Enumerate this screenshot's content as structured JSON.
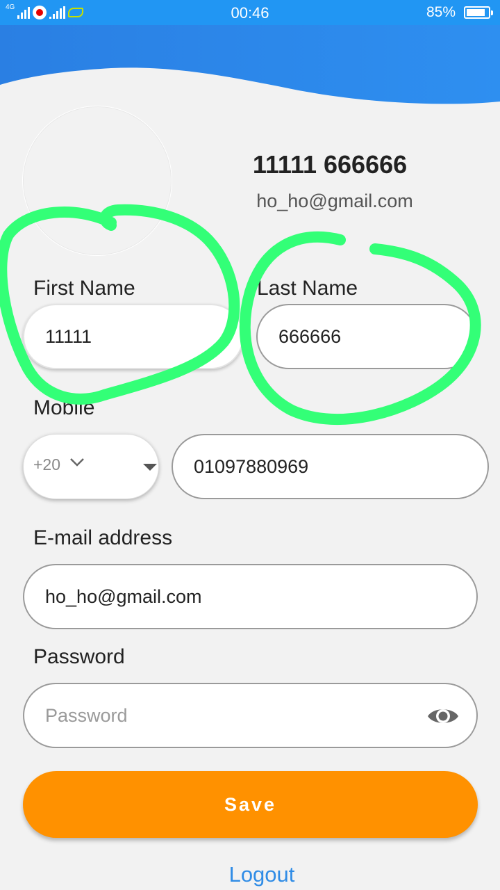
{
  "status_bar": {
    "network_label": "4G",
    "time": "00:46",
    "battery_percent_text": "85%",
    "battery_level": 0.85
  },
  "profile": {
    "name": "11111 666666",
    "email": "ho_ho@gmail.com"
  },
  "form": {
    "first_name_label": "First Name",
    "first_name_value": "11111",
    "last_name_label": "Last Name",
    "last_name_value": "666666",
    "mobile_label": "Mobile",
    "country_code": "+20",
    "mobile_value": "01097880969",
    "email_label": "E-mail address",
    "email_value": "ho_ho@gmail.com",
    "password_label": "Password",
    "password_placeholder": "Password",
    "password_value": ""
  },
  "actions": {
    "save_label": "Save",
    "logout_label": "Logout"
  },
  "colors": {
    "header_blue": "#2196f3",
    "save_orange": "#ff9100",
    "link_blue": "#2f8ce6",
    "annotation_green": "#33ff77"
  },
  "icons": [
    "signal-icon",
    "vodafone-icon",
    "etisalat-icon",
    "battery-icon",
    "chevron-down-icon",
    "dropdown-caret-icon",
    "eye-icon"
  ]
}
